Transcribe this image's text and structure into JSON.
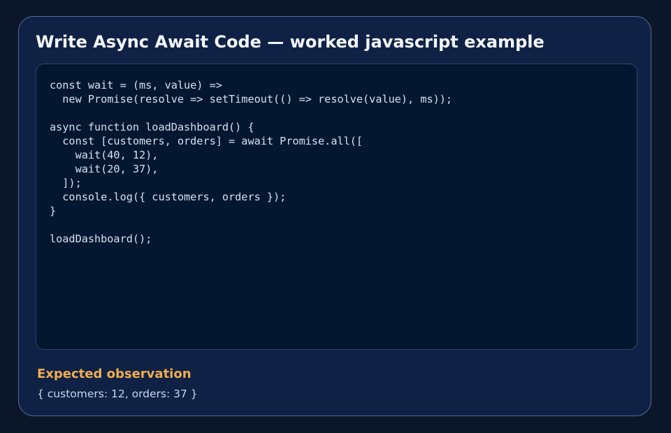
{
  "card": {
    "title": "Write Async Await Code — worked javascript example"
  },
  "code": {
    "language": "javascript",
    "lines": [
      "const wait = (ms, value) =>",
      "  new Promise(resolve => setTimeout(() => resolve(value), ms));",
      "",
      "async function loadDashboard() {",
      "  const [customers, orders] = await Promise.all([",
      "    wait(40, 12),",
      "    wait(20, 37),",
      "  ]);",
      "  console.log({ customers, orders });",
      "}",
      "",
      "loadDashboard();"
    ]
  },
  "observation": {
    "heading": "Expected observation",
    "value": "{ customers: 12, orders: 37 }"
  },
  "colors": {
    "page_background": "#0b1628",
    "card_background": "#0f2246",
    "card_border": "#4f6f9e",
    "code_background": "#041730",
    "title_text": "#f4f7fc",
    "code_text": "#d6e1f2",
    "observation_heading": "#f2ad4e",
    "observation_text": "#c9d6ea"
  }
}
